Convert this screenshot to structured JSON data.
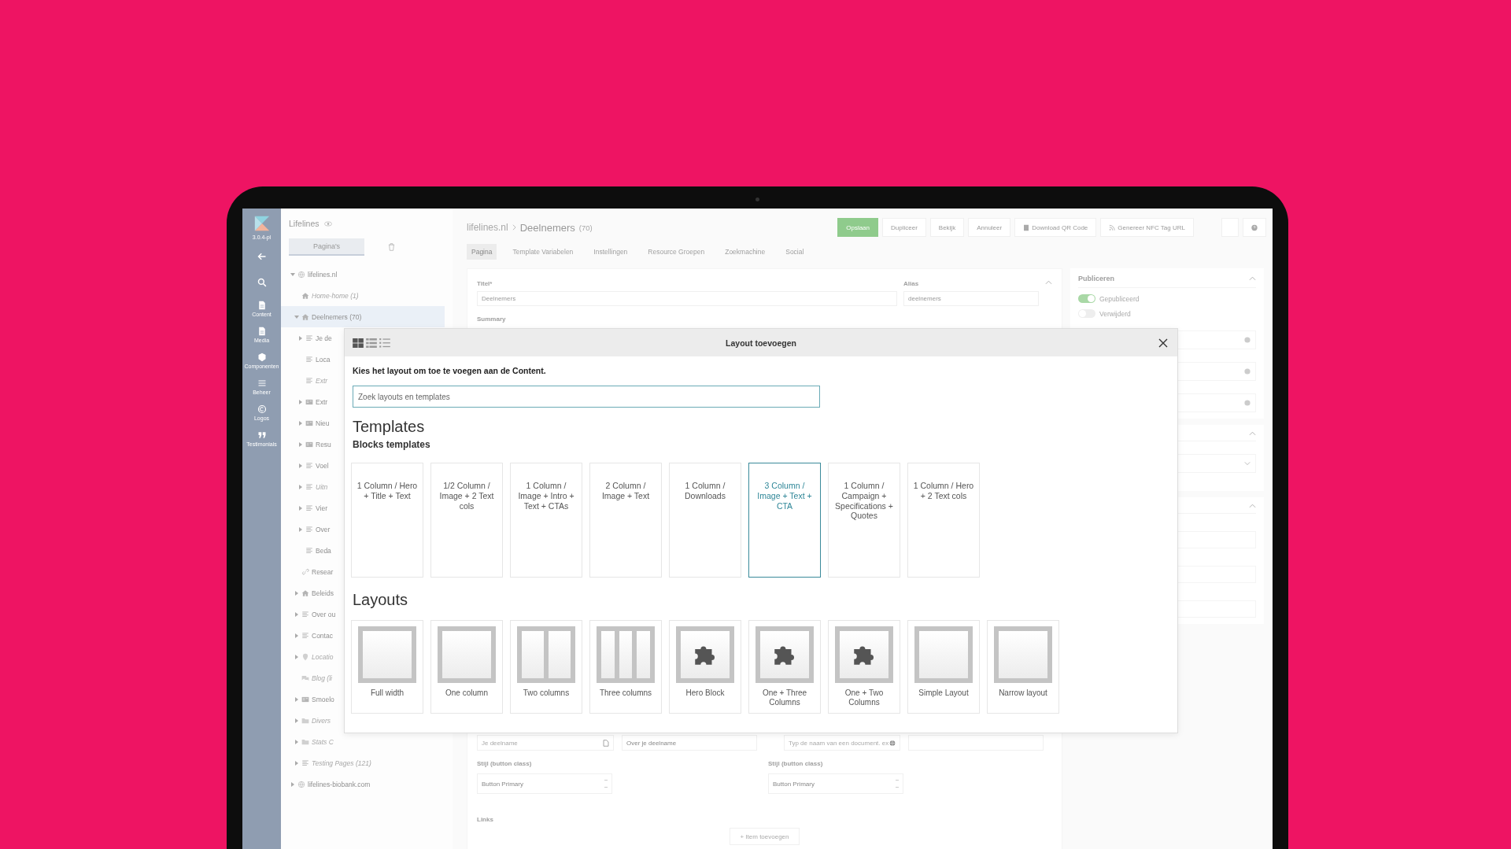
{
  "sidebar": {
    "version": "3.0.4-pl",
    "items": [
      {
        "kind": "back"
      },
      {
        "kind": "search"
      },
      {
        "kind": "content",
        "label": "Content"
      },
      {
        "kind": "media",
        "label": "Media"
      },
      {
        "kind": "components",
        "label": "Componenten"
      },
      {
        "kind": "manage",
        "label": "Beheer"
      },
      {
        "kind": "logos",
        "label": "Logos"
      },
      {
        "kind": "quotes",
        "label": "Testimonials"
      }
    ]
  },
  "tree_panel": {
    "title": "Lifelines",
    "tabs": [
      {
        "label": "Pagina's",
        "selected": true
      }
    ],
    "items": [
      {
        "label": "lifelines.nl",
        "kind": "globe",
        "expanded": true,
        "selected": false,
        "muted": false,
        "children": [
          {
            "label": "Home-home (1)",
            "kind": "home",
            "selected": false,
            "muted": true
          },
          {
            "label": "Deelnemers (70)",
            "kind": "home",
            "expanded": true,
            "selected": true,
            "muted": false,
            "children": [
              {
                "label": "Je de",
                "kind": "page",
                "expanded": false,
                "selected": false,
                "muted": false
              },
              {
                "label": "Loca",
                "kind": "page",
                "selected": false,
                "muted": false
              },
              {
                "label": "Extr",
                "kind": "page",
                "selected": false,
                "muted": true
              },
              {
                "label": "Extr",
                "kind": "card",
                "expanded": false,
                "selected": false,
                "muted": false
              },
              {
                "label": "Nieu",
                "kind": "card",
                "expanded": false,
                "selected": false,
                "muted": false
              },
              {
                "label": "Resu",
                "kind": "card",
                "expanded": false,
                "selected": false,
                "muted": false
              },
              {
                "label": "Voel",
                "kind": "page",
                "expanded": false,
                "selected": false,
                "muted": false
              },
              {
                "label": "Uitn",
                "kind": "page",
                "expanded": false,
                "selected": false,
                "muted": true
              },
              {
                "label": "Vier",
                "kind": "page",
                "expanded": false,
                "selected": false,
                "muted": false
              },
              {
                "label": "Over",
                "kind": "page",
                "expanded": false,
                "selected": false,
                "muted": false
              },
              {
                "label": "Beda",
                "kind": "page",
                "selected": false,
                "muted": false
              }
            ]
          },
          {
            "label": "Resear",
            "kind": "link",
            "selected": false,
            "muted": false
          },
          {
            "label": "Beleids",
            "kind": "home",
            "expanded": false,
            "selected": false,
            "muted": false
          },
          {
            "label": "Over ou",
            "kind": "page",
            "expanded": false,
            "selected": false,
            "muted": false
          },
          {
            "label": "Contac",
            "kind": "page",
            "expanded": false,
            "selected": false,
            "muted": false
          },
          {
            "label": "Locatio",
            "kind": "pin",
            "expanded": false,
            "selected": false,
            "muted": true
          },
          {
            "label": "Blog (li",
            "kind": "chat",
            "selected": false,
            "muted": true
          },
          {
            "label": "Smoelo",
            "kind": "card",
            "expanded": false,
            "selected": false,
            "muted": false
          },
          {
            "label": "Divers",
            "kind": "folder",
            "expanded": false,
            "selected": false,
            "muted": true
          },
          {
            "label": "Stats C",
            "kind": "folder",
            "expanded": false,
            "selected": false,
            "muted": true
          },
          {
            "label": "Testing Pages (121)",
            "kind": "page",
            "expanded": false,
            "selected": false,
            "muted": true
          }
        ]
      },
      {
        "label": "lifelines-biobank.com",
        "kind": "globe",
        "expanded": false,
        "selected": false,
        "muted": false
      }
    ]
  },
  "header": {
    "breadcrumb": [
      "lifelines.nl",
      "Deelnemers"
    ],
    "count": "(70)",
    "actions": [
      {
        "kind": "primary",
        "label": "Opslaan"
      },
      {
        "kind": "plain",
        "label": "Dupliceer"
      },
      {
        "kind": "plain",
        "label": "Bekijk"
      },
      {
        "kind": "plain",
        "label": "Annuleer"
      },
      {
        "kind": "qr",
        "label": "Download QR Code"
      },
      {
        "kind": "rss",
        "label": "Genereer NFC Tag URL"
      },
      {
        "kind": "trash"
      },
      {
        "kind": "help"
      }
    ]
  },
  "tabs": [
    {
      "label": "Pagina",
      "selected": true
    },
    {
      "label": "Template Variabelen",
      "selected": false
    },
    {
      "label": "Instellingen",
      "selected": false
    },
    {
      "label": "Resource Groepen",
      "selected": false
    },
    {
      "label": "Zoekmachine",
      "selected": false
    },
    {
      "label": "Social",
      "selected": false
    }
  ],
  "form": {
    "title_label": "Titel*",
    "title_value": "Deelnemers",
    "alias_label": "Alias",
    "alias_value": "deelnemers",
    "summary_label": "Summary",
    "link_fields": [
      {
        "kind": "doc",
        "placeholder": "Je deelname"
      },
      {
        "kind": "text",
        "value": "Over je deelname"
      },
      {
        "kind": "globe",
        "placeholder": "Typ de naam van een document. ex"
      },
      {
        "kind": "text"
      }
    ],
    "style_label": [
      "Stijl (button class)",
      "Stijl (button class)"
    ],
    "style_value": [
      "Button Primary",
      "Button Primary"
    ],
    "links_label": "Links",
    "add_button": "+ Item toevoegen"
  },
  "publish": {
    "title": "Publiceren",
    "toggles": [
      {
        "label": "Gepubliceerd",
        "on": true
      },
      {
        "label": "Verwijderd",
        "on": false
      }
    ]
  },
  "modal": {
    "title": "Layout toevoegen",
    "views": [
      {
        "kind": "grid",
        "selected": true
      },
      {
        "kind": "list",
        "selected": false
      },
      {
        "kind": "bullets",
        "selected": false
      }
    ],
    "intro": "Kies het layout om toe te voegen aan de Content.",
    "search_placeholder": "Zoek layouts en templates",
    "templates_heading": "Templates",
    "templates_subheading": "Blocks templates",
    "templates": [
      {
        "label": "1 Column / Hero + Title + Text",
        "selected": false
      },
      {
        "label": "1/2 Column / Image + 2 Text cols",
        "selected": false
      },
      {
        "label": "1 Column / Image + Intro + Text + CTAs",
        "selected": false
      },
      {
        "label": "2 Column / Image + Text",
        "selected": false
      },
      {
        "label": "1 Column / Downloads",
        "selected": false
      },
      {
        "label": "3 Column / Image + Text + CTA",
        "selected": true
      },
      {
        "label": "1 Column / Campaign + Specifications + Quotes",
        "selected": false
      },
      {
        "label": "1 Column / Hero + 2 Text cols",
        "selected": false
      }
    ],
    "layouts_heading": "Layouts",
    "layouts": [
      {
        "label": "Full width",
        "kind": "single"
      },
      {
        "label": "One column",
        "kind": "single"
      },
      {
        "label": "Two columns",
        "kind": "two"
      },
      {
        "label": "Three columns",
        "kind": "three"
      },
      {
        "label": "Hero Block",
        "kind": "puzzle"
      },
      {
        "label": "One + Three Columns",
        "kind": "puzzle"
      },
      {
        "label": "One + Two Columns",
        "kind": "puzzle"
      },
      {
        "label": "Simple Layout",
        "kind": "single"
      },
      {
        "label": "Narrow layout",
        "kind": "single"
      }
    ]
  }
}
